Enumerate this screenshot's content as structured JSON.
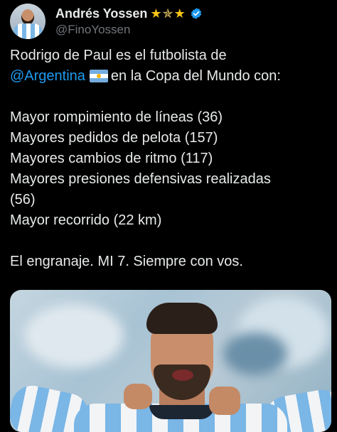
{
  "author": {
    "display_name": "Andrés Yossen",
    "handle": "@FinoYossen",
    "avatar_icon": "avatar-photo",
    "badges": [
      "star-icon",
      "sparkle-star-icon",
      "star-icon",
      "verified-badge-icon"
    ],
    "verified_color": "#1d9bf0"
  },
  "tweet": {
    "line1": "Rodrigo de Paul es el futbolista de",
    "mention": "@Argentina",
    "flag_icon": "argentina-flag-icon",
    "line2_rest": "en la Copa del Mundo con:",
    "stats": [
      "Mayor rompimiento de líneas (36)",
      "Mayores pedidos de pelota (157)",
      "Mayores cambios de ritmo (117)",
      "Mayores presiones defensivas realizadas",
      "(56)",
      "Mayor recorrido (22 km)"
    ],
    "closing": "El engranaje. MI 7. Siempre con vos."
  },
  "media": {
    "type": "photo",
    "description_icon": "player-photo"
  },
  "colors": {
    "background": "#000000",
    "text": "#e7e9ea",
    "secondary_text": "#71767b",
    "link": "#1d9bf0",
    "star": "#f5c518"
  }
}
